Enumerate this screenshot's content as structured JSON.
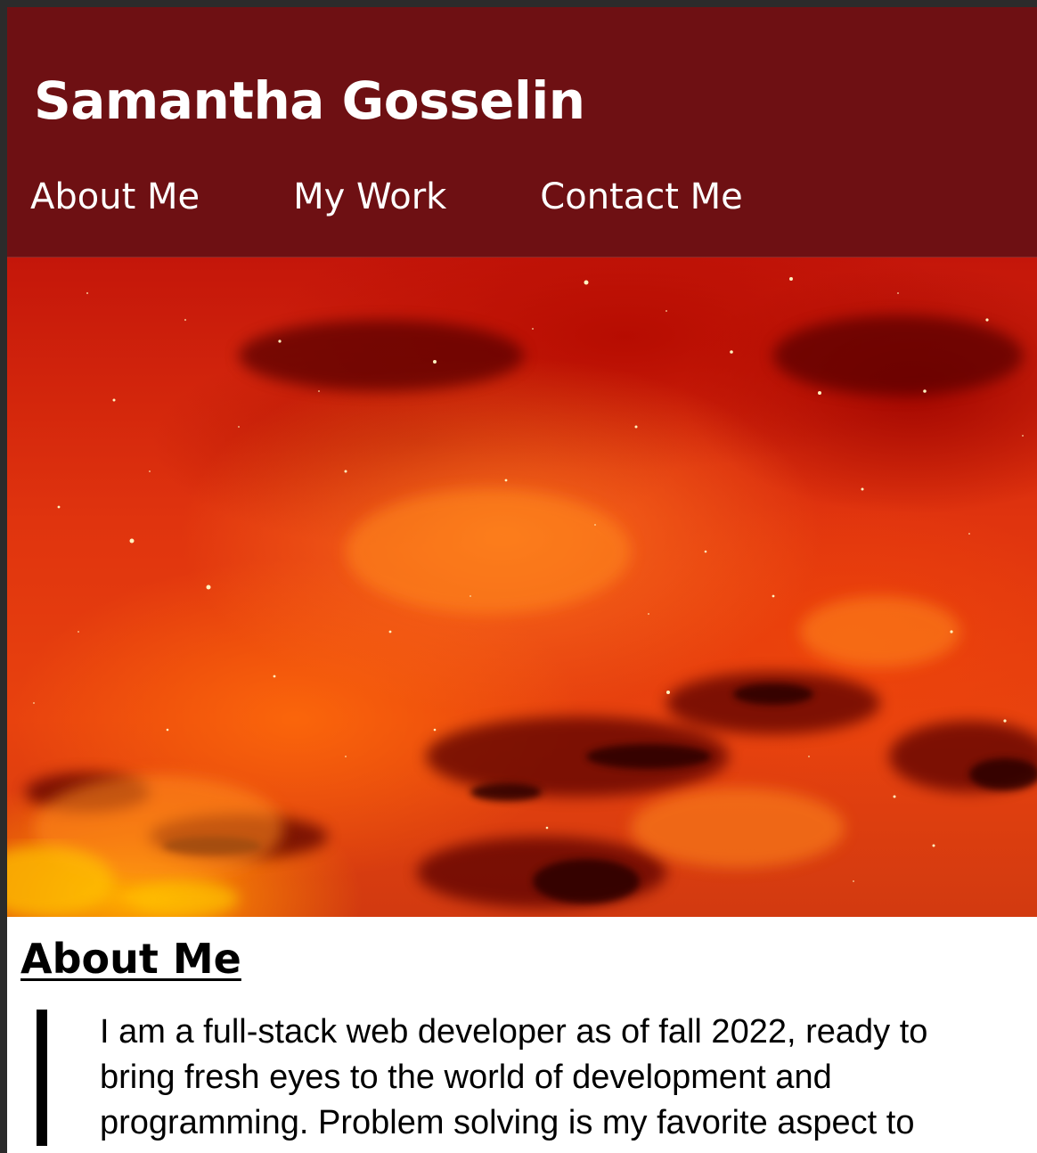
{
  "header": {
    "site_title": "Samantha Gosselin",
    "background_color": "#6e1013"
  },
  "nav": {
    "items": [
      {
        "label": "About Me"
      },
      {
        "label": "My Work"
      },
      {
        "label": "Contact Me"
      }
    ]
  },
  "hero": {
    "description": "red and orange nebula starfield banner image"
  },
  "about": {
    "heading": "About Me",
    "text": "I am a full-stack web developer as of fall 2022, ready to bring fresh eyes to the world of development and programming. Problem solving is my favorite aspect to"
  }
}
